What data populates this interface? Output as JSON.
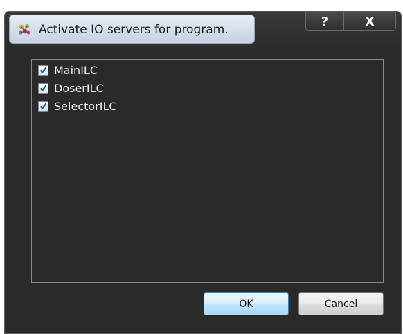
{
  "window": {
    "title": "Activate IO servers for program.",
    "help_glyph": "?",
    "close_glyph": "X"
  },
  "servers": [
    {
      "label": "MainILC",
      "checked": true
    },
    {
      "label": "DoserILC",
      "checked": true
    },
    {
      "label": "SelectorILC",
      "checked": true
    }
  ],
  "buttons": {
    "ok_label": "OK",
    "cancel_label": "Cancel"
  },
  "colors": {
    "window_background": "#2a2a2a",
    "text": "#f0f0f0",
    "check_mark": "#2b5797"
  },
  "icons": {
    "app": "servers-icon",
    "help": "help-icon",
    "close": "close-icon",
    "check": "checkmark-icon"
  }
}
